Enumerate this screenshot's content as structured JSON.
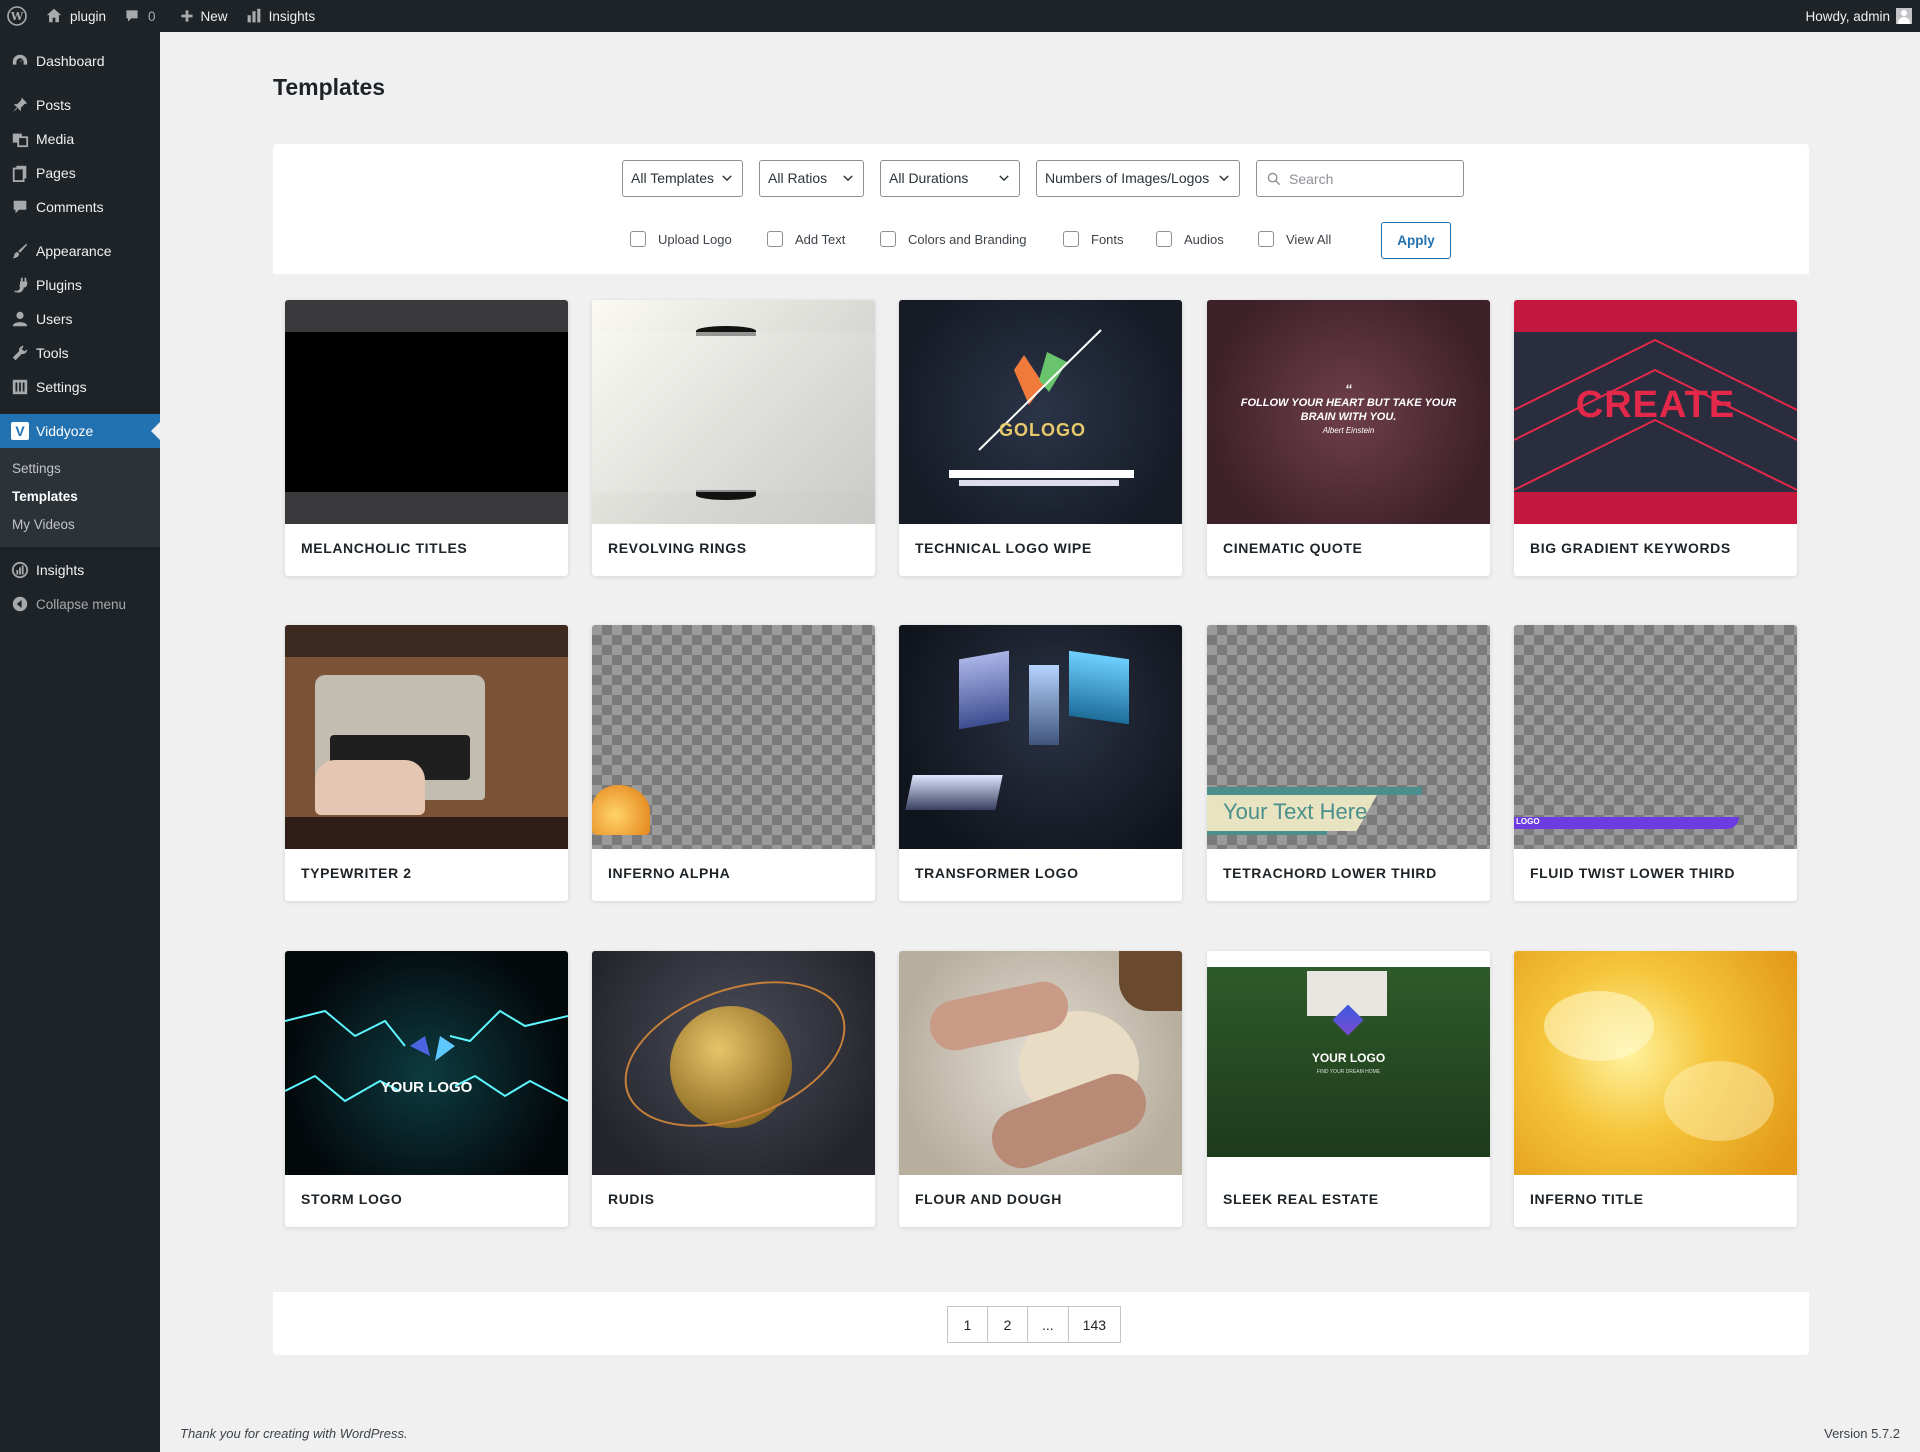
{
  "adminbar": {
    "site_name": "plugin",
    "comments_count": "0",
    "new_label": "New",
    "insights_label": "Insights",
    "howdy": "Howdy, admin"
  },
  "sidebar": {
    "items": [
      {
        "label": "Dashboard",
        "icon": "dashboard-icon"
      },
      {
        "label": "Posts",
        "icon": "pin-icon"
      },
      {
        "label": "Media",
        "icon": "media-icon"
      },
      {
        "label": "Pages",
        "icon": "pages-icon"
      },
      {
        "label": "Comments",
        "icon": "comment-icon"
      },
      {
        "label": "Appearance",
        "icon": "brush-icon"
      },
      {
        "label": "Plugins",
        "icon": "plug-icon"
      },
      {
        "label": "Users",
        "icon": "user-icon"
      },
      {
        "label": "Tools",
        "icon": "wrench-icon"
      },
      {
        "label": "Settings",
        "icon": "settings-icon"
      },
      {
        "label": "Viddyoze",
        "icon": "viddyoze-icon"
      },
      {
        "label": "Insights",
        "icon": "insights-icon"
      },
      {
        "label": "Collapse menu",
        "icon": "collapse-icon"
      }
    ],
    "submenu": [
      "Settings",
      "Templates",
      "My Videos"
    ]
  },
  "page_title": "Templates",
  "filters": {
    "templates": "All Templates",
    "ratios": "All Ratios",
    "durations": "All Durations",
    "images": "Numbers of Images/Logos",
    "search_placeholder": "Search",
    "checkboxes": [
      "Upload Logo",
      "Add Text",
      "Colors and Branding",
      "Fonts",
      "Audios",
      "View All"
    ],
    "apply": "Apply"
  },
  "templates": [
    "MELANCHOLIC TITLES",
    "REVOLVING RINGS",
    "TECHNICAL LOGO WIPE",
    "CINEMATIC QUOTE",
    "BIG GRADIENT KEYWORDS",
    "TYPEWRITER 2",
    "INFERNO ALPHA",
    "TRANSFORMER LOGO",
    "TETRACHORD LOWER THIRD",
    "FLUID TWIST LOWER THIRD",
    "STORM LOGO",
    "RUDIS",
    "FLOUR AND DOUGH",
    "SLEEK REAL ESTATE",
    "INFERNO TITLE"
  ],
  "thumb_text": {
    "technical_logo": "GOLOGO",
    "quote_line1": "FOLLOW YOUR HEART BUT TAKE YOUR",
    "quote_line2": "BRAIN WITH YOU.",
    "quote_author": "Albert Einstein",
    "create": "CREATE",
    "lower_third": "Your Text Here",
    "fluid_logo": "LOGO",
    "storm_logo": "YOUR LOGO",
    "real_estate_logo": "YOUR LOGO",
    "real_estate_tagline": "FIND YOUR DREAM HOME"
  },
  "pagination": [
    "1",
    "2",
    "...",
    "143"
  ],
  "footer": {
    "thanks": "Thank you for creating with WordPress.",
    "version": "Version 5.7.2"
  },
  "colors": {
    "admin_dark": "#1d2327",
    "accent_blue": "#2271b1",
    "background": "#f0f0f1"
  }
}
